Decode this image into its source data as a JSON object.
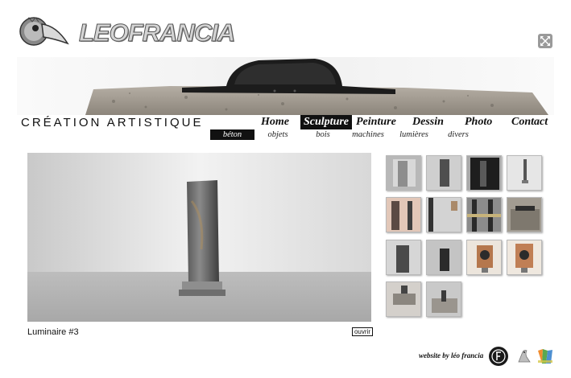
{
  "site": {
    "logo_text": "LEOFRANCIA",
    "tagline": "CRÉATION ARTISTIQUE"
  },
  "nav": {
    "items": [
      {
        "label": "Home",
        "active": false
      },
      {
        "label": "Sculpture",
        "active": true
      },
      {
        "label": "Peinture",
        "active": false
      },
      {
        "label": "Dessin",
        "active": false
      },
      {
        "label": "Photo",
        "active": false
      },
      {
        "label": "Contact",
        "active": false
      }
    ],
    "subitems": [
      {
        "label": "béton",
        "active": true
      },
      {
        "label": "objets",
        "active": false
      },
      {
        "label": "bois",
        "active": false
      },
      {
        "label": "machines",
        "active": false
      },
      {
        "label": "lumières",
        "active": false
      },
      {
        "label": "divers",
        "active": false
      }
    ]
  },
  "viewer": {
    "caption": "Luminaire #3",
    "open_label": "ouvrir"
  },
  "thumbnails": {
    "count": 14
  },
  "footer": {
    "credit": "website by léo francia",
    "icons": [
      "leofrancia-badge-icon",
      "bird-icon",
      "colorful-flag-icon"
    ]
  },
  "colors": {
    "text": "#111111",
    "active_bg": "#111111",
    "active_text": "#ffffff"
  },
  "icons": {
    "fullscreen": "expand-arrows-icon",
    "logo": "bird-mask-icon"
  }
}
